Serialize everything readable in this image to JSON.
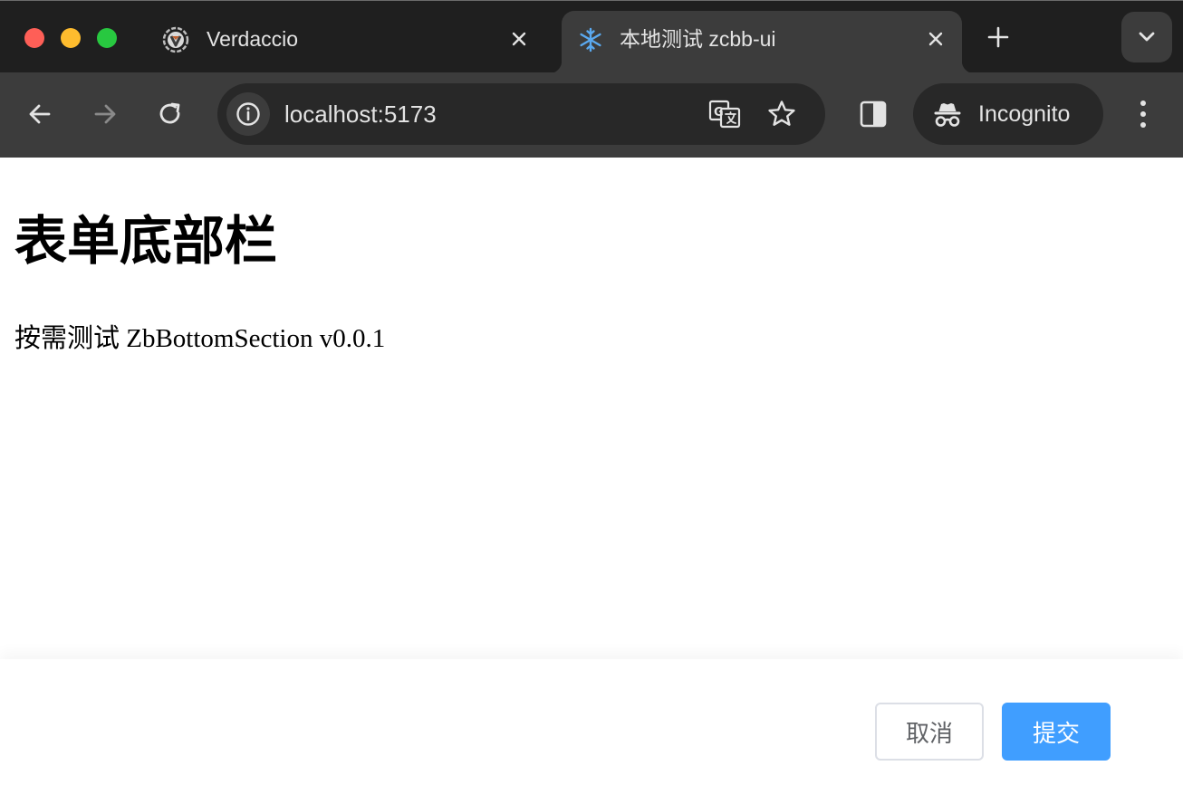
{
  "window": {
    "traffic_lights": {
      "close": "#fe5f57",
      "minimize": "#febc2e",
      "zoom": "#28c840"
    }
  },
  "tabs": [
    {
      "title": "Verdaccio",
      "favicon": "verdaccio-logo-icon",
      "active": false
    },
    {
      "title": "本地测试 zcbb-ui",
      "favicon": "snowflake-icon",
      "active": true
    }
  ],
  "toolbar": {
    "url": "localhost:5173",
    "incognito_label": "Incognito"
  },
  "page": {
    "title": "表单底部栏",
    "description": "按需测试 ZbBottomSection v0.0.1"
  },
  "bottom_section": {
    "cancel_label": "取消",
    "submit_label": "提交",
    "primary_color": "#409eff"
  }
}
